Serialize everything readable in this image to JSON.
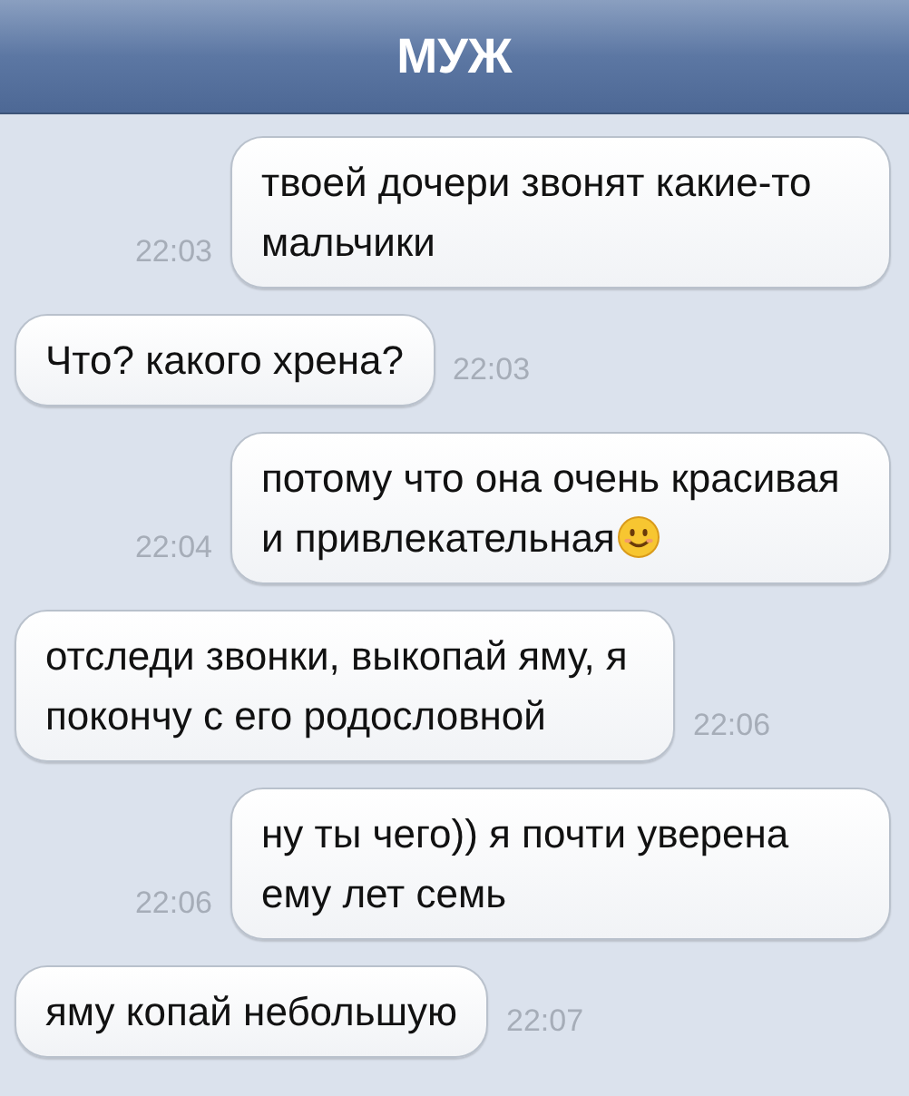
{
  "header": {
    "title": "МУЖ"
  },
  "messages": [
    {
      "kind": "sent",
      "text": "твоей дочери звонят какие-то мальчики",
      "time": "22:03",
      "emoji": false
    },
    {
      "kind": "received",
      "text": "Что? какого хрена?",
      "time": "22:03",
      "emoji": false
    },
    {
      "kind": "sent",
      "text": "потому что она очень красивая и привлекательная",
      "time": "22:04",
      "emoji": true
    },
    {
      "kind": "received",
      "text": "отследи звонки, выкопай яму, я покончу с его родословной",
      "time": "22:06",
      "emoji": false
    },
    {
      "kind": "sent",
      "text": "ну ты чего)) я почти уверена ему лет семь",
      "time": "22:06",
      "emoji": false
    },
    {
      "kind": "received",
      "text": "яму копай небольшую",
      "time": "22:07",
      "emoji": false
    }
  ]
}
